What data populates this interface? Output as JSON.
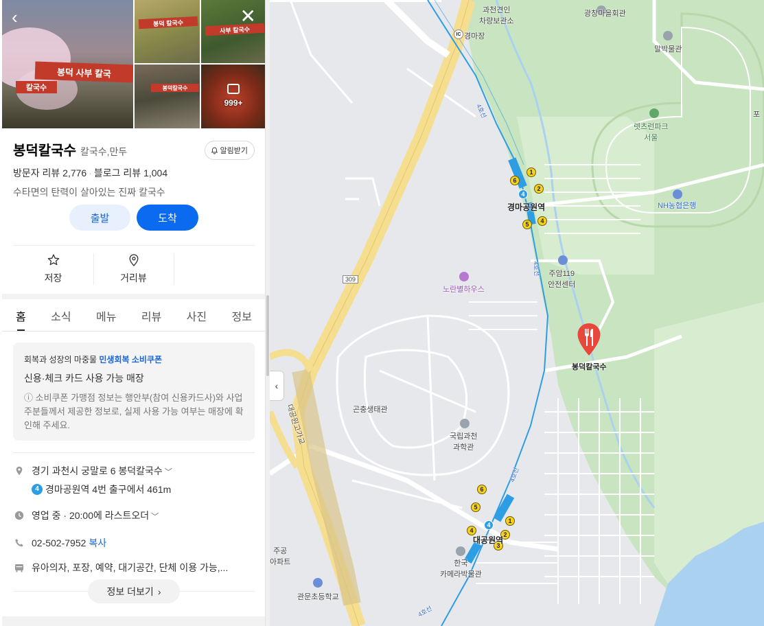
{
  "place": {
    "name": "봉덕칼국수",
    "category": "칼국수,만두",
    "alarm_label": "알림받기",
    "visitor_reviews": "방문자 리뷰 2,776",
    "blog_reviews": "블로그 리뷰 1,004",
    "description": "수타면의 탄력이 살아있는 진짜 칼국수",
    "photo_count": "999+"
  },
  "buttons": {
    "depart": "출발",
    "arrive": "도착"
  },
  "actions": [
    {
      "label": "저장",
      "icon": "star-icon"
    },
    {
      "label": "거리뷰",
      "icon": "pin-icon"
    }
  ],
  "tabs": [
    "홈",
    "소식",
    "메뉴",
    "리뷰",
    "사진",
    "정보"
  ],
  "active_tab": "홈",
  "coupon": {
    "head_prefix": "회복과 성장의 마중물",
    "head_highlight": "민생회복 소비쿠폰",
    "sub": "신용·체크 카드 사용 가능 매장",
    "note": "ⓘ 소비쿠폰 가맹점 정보는 행안부(참여 신용카드사)와 사업주분들께서 제공한 정보로, 실제 사용 가능 여부는 매장에 확인해 주세요."
  },
  "details": {
    "address": "경기 과천시 궁말로 6 봉덕칼국수",
    "subway_line": "4",
    "subway_info": "경마공원역 4번 출구에서 461m",
    "hours": "영업 중 · 20:00에 라스트오더",
    "phone": "02-502-7952",
    "copy_label": "복사",
    "amenities": "유아의자, 포장, 예약, 대기공간, 단체 이용 가능,..."
  },
  "more_info_label": "정보 더보기",
  "map": {
    "labels": {
      "gwacheon_depot": "과천견인\n차량보관소",
      "ic": "경마장",
      "ic_badge": "IC",
      "gwangchang_hall": "광창마을회관",
      "horse_museum": "말박물관",
      "lets_run_park": "렛츠런파크\n서울",
      "nh_bank": "NH농협은행",
      "station_racecourse": "경마공원역",
      "safety_center": "주암119\n안전센터",
      "noran_house": "노란별하우스",
      "restaurant": "봉덕칼국수",
      "insect_ecology": "곤충생태관",
      "science_museum": "국립과천\n과학관",
      "station_grandpark": "대공원역",
      "camera_museum": "한국\n카메라박물관",
      "elementary_school": "관문초등학교",
      "apartment": "주공\n아파트",
      "overpass": "대공원고가교",
      "road_309": "309",
      "line4_upper": "4호선",
      "line4_mid": "4호선",
      "line4_lower": "4호선",
      "line4_bottom": "4호선",
      "edge_po": "포"
    },
    "colors": {
      "park": "#c9e4c0",
      "grass": "#d8ecd0",
      "urban": "#e6e8ec",
      "road": "#ffffff",
      "highway": "#f6de91",
      "water": "#aad2f0",
      "subway": "#2d9de4",
      "poi_red": "#e8473c"
    }
  }
}
